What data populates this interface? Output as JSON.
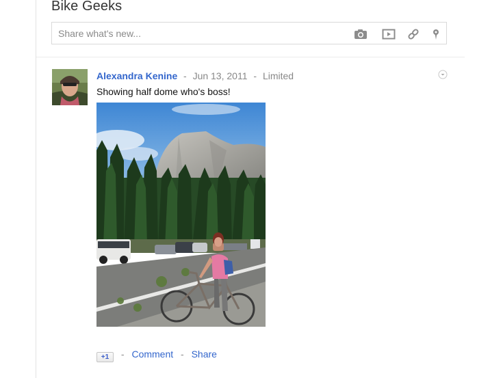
{
  "page": {
    "title": "Bike Geeks"
  },
  "share_box": {
    "placeholder": "Share what's new...",
    "icons": [
      "camera-icon",
      "video-icon",
      "link-icon",
      "location-pin-icon"
    ]
  },
  "post": {
    "author": "Alexandra Kenine",
    "separator": "-",
    "date": "Jun 13, 2011",
    "visibility": "Limited",
    "text": "Showing half dome who's boss!",
    "actions": {
      "plus_one": "+1",
      "separator": "-",
      "comment": "Comment",
      "share": "Share"
    }
  },
  "colors": {
    "link": "#3366cc",
    "muted": "#888888",
    "border": "#d9d9d9"
  }
}
